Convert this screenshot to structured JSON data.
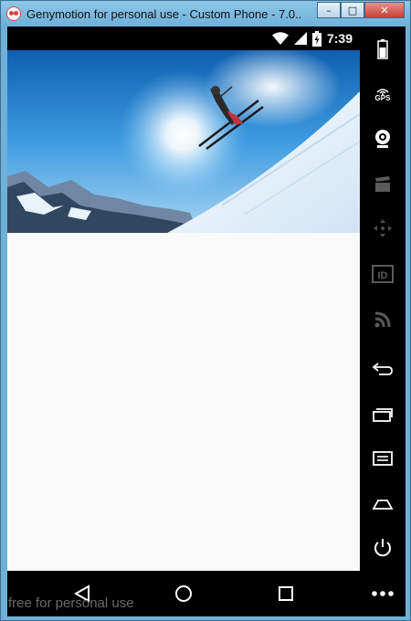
{
  "window": {
    "title": "Genymotion for personal use - Custom Phone - 7.0....",
    "controls": {
      "minimize": "–",
      "maximize": "□",
      "close": "✕"
    }
  },
  "statusbar": {
    "time": "7:39",
    "icons": [
      "wifi-icon",
      "cell-signal-icon",
      "battery-icon"
    ]
  },
  "screen": {
    "hero_image": "skier-jumping-snow-slope-photo"
  },
  "navbar": {
    "buttons": [
      "back-icon",
      "home-icon",
      "recents-icon"
    ]
  },
  "watermark": "free for personal use",
  "toolbar": {
    "gps_label": "GPS",
    "id_label": "ID",
    "items": [
      "battery",
      "gps",
      "webcam",
      "video-capture",
      "dpad",
      "identifiers",
      "rss-network",
      "back",
      "recent-apps",
      "menu",
      "home",
      "power",
      "more"
    ]
  },
  "colors": {
    "frame": "#6fb0d8",
    "screen_bg": "#f9f9fa",
    "bar_bg": "#000000"
  }
}
